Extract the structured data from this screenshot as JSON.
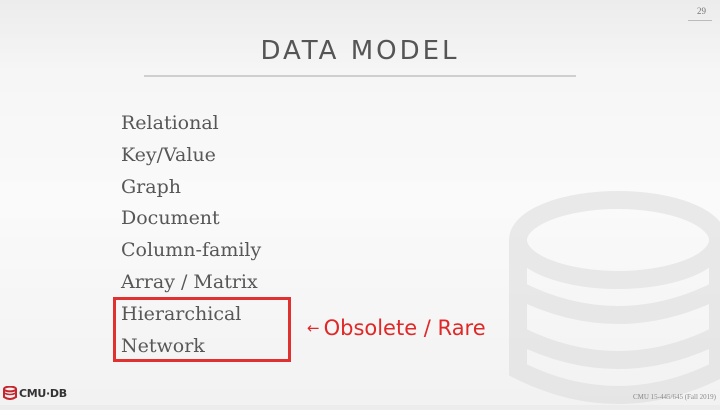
{
  "slide": {
    "page_number": "29",
    "title": "DATA MODEL",
    "models": [
      "Relational",
      "Key/Value",
      "Graph",
      "Document",
      "Column-family",
      "Array / Matrix",
      "Hierarchical",
      "Network"
    ],
    "annotation": {
      "arrow": "←",
      "text": "Obsolete / Rare",
      "color": "#e02828"
    },
    "highlight_color": "#e03030",
    "logo_text": "CMU·DB",
    "footer": "CMU 15-445/645 (Fall 2019)"
  }
}
